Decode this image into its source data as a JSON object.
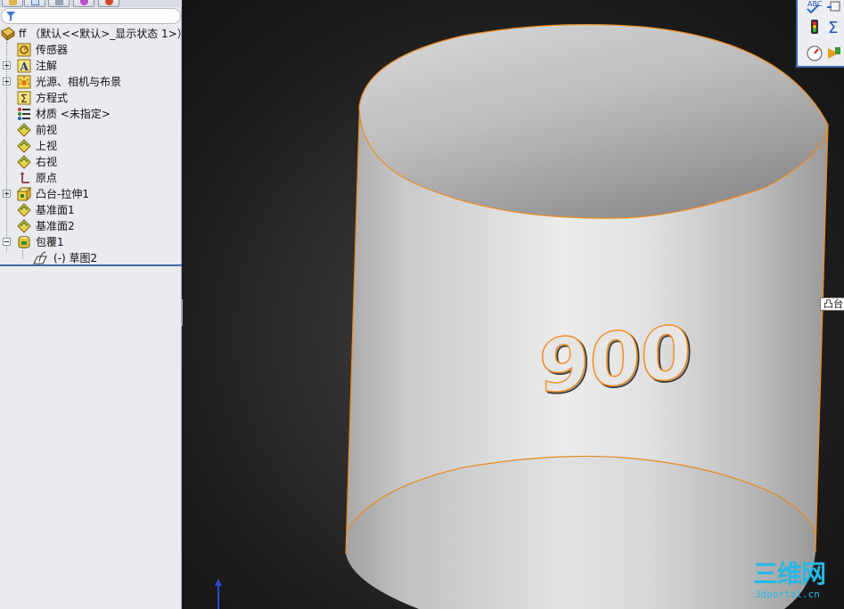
{
  "tree": {
    "root": "ff （默认<<默认>_显示状态 1>）",
    "items": [
      {
        "label": "传感器",
        "icon": "sensor-icon"
      },
      {
        "label": "注解",
        "icon": "annotation-icon",
        "expand": "plus"
      },
      {
        "label": "光源、相机与布景",
        "icon": "lights-icon",
        "expand": "plus"
      },
      {
        "label": "方程式",
        "icon": "equation-icon"
      },
      {
        "label": "材质 <未指定>",
        "icon": "material-icon"
      },
      {
        "label": "前视",
        "icon": "plane-icon"
      },
      {
        "label": "上视",
        "icon": "plane-icon"
      },
      {
        "label": "右视",
        "icon": "plane-icon"
      },
      {
        "label": "原点",
        "icon": "origin-icon"
      },
      {
        "label": "凸台-拉伸1",
        "icon": "boss-extrude-icon",
        "expand": "plus"
      },
      {
        "label": "基准面1",
        "icon": "plane-icon"
      },
      {
        "label": "基准面2",
        "icon": "plane-icon"
      },
      {
        "label": "包覆1",
        "icon": "wrap-icon",
        "expand": "minus"
      }
    ],
    "child": "(-) 草图2"
  },
  "viewport": {
    "embossed_text": "900",
    "tooltip": "凸台",
    "task_toolbar_label": "ABC"
  },
  "watermark": {
    "main": "三维网",
    "sub": "3dportal.cn"
  },
  "colors": {
    "edge_highlight": "#f08a1c",
    "selection_line": "#3c6aa8",
    "toolbar_border": "#3a67b0"
  }
}
